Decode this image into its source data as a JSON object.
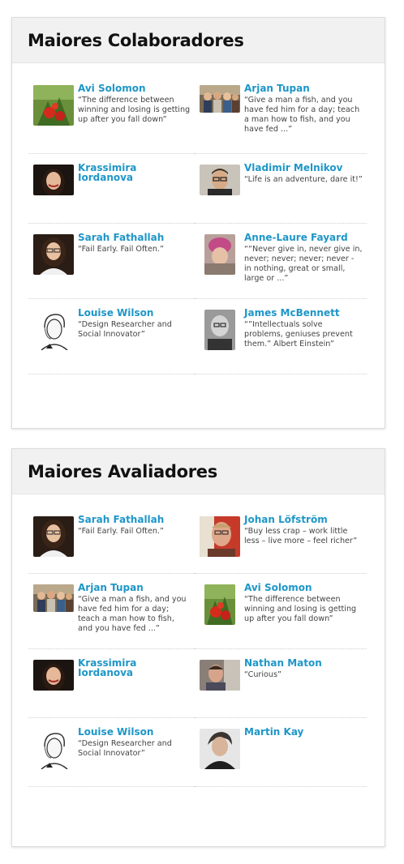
{
  "panels": [
    {
      "title": "Maiores Colaboradores",
      "people": [
        {
          "name": "Avi Solomon",
          "quote": "“The difference between winning and losing is getting up after you fall down”",
          "avatar": "tomato-plant-icon"
        },
        {
          "name": "Arjan Tupan",
          "quote": "“Give a man a fish, and you have fed him for a day; teach a man how to fish, and you have fed ...”",
          "avatar": "group-photo-icon"
        },
        {
          "name": "Krassimira Iordanova",
          "quote": "",
          "avatar": "woman-portrait-icon"
        },
        {
          "name": "Vladimir Melnikov",
          "quote": "“Life is an adventure, dare it!”",
          "avatar": "man-glasses-icon"
        },
        {
          "name": "Sarah Fathallah",
          "quote": "“Fail Early. Fail Often.”",
          "avatar": "woman-glasses-icon"
        },
        {
          "name": "Anne-Laure Fayard",
          "quote": "““Never give in, never give in, never; never; never; never - in nothing, great or small, large or ...”",
          "avatar": "pink-hat-icon"
        },
        {
          "name": "Louise Wilson",
          "quote": "“Design Researcher and Social Innovator”",
          "avatar": "sketch-portrait-icon"
        },
        {
          "name": "James McBennett",
          "quote": "“”Intellectuals solve problems, geniuses prevent them.” Albert Einstein”",
          "avatar": "bw-portrait-icon"
        }
      ]
    },
    {
      "title": "Maiores Avaliadores",
      "people": [
        {
          "name": "Sarah Fathallah",
          "quote": "“Fail Early. Fail Often.”",
          "avatar": "woman-glasses-icon"
        },
        {
          "name": "Johan Löfström",
          "quote": "“Buy less crap – work little less – live more – feel richer”",
          "avatar": "man-red-bg-icon"
        },
        {
          "name": "Arjan Tupan",
          "quote": "“Give a man a fish, and you have fed him for a day; teach a man how to fish, and you have fed ...”",
          "avatar": "group-photo-icon"
        },
        {
          "name": "Avi Solomon",
          "quote": "“The difference between winning and losing is getting up after you fall down”",
          "avatar": "tomato-plant-icon"
        },
        {
          "name": "Krassimira Iordanova",
          "quote": "",
          "avatar": "woman-portrait-icon"
        },
        {
          "name": "Nathan Maton",
          "quote": "“Curious”",
          "avatar": "man-room-icon"
        },
        {
          "name": "Louise Wilson",
          "quote": "“Design Researcher and Social Innovator”",
          "avatar": "sketch-portrait-icon"
        },
        {
          "name": "Martin Kay",
          "quote": "",
          "avatar": "man-dark-icon"
        }
      ]
    }
  ]
}
